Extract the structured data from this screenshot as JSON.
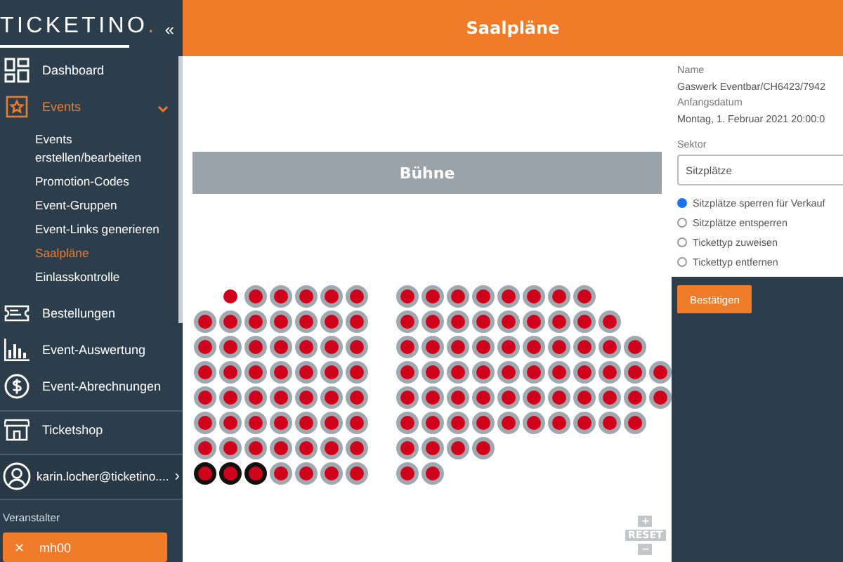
{
  "sidebar": {
    "logo": "TICKETINO",
    "logo_dot": ".",
    "collapse": "«",
    "items": [
      {
        "label": "Dashboard",
        "selected": false
      },
      {
        "label": "Events",
        "selected": true,
        "expanded": true,
        "children": [
          {
            "label": "Events erstellen/bearbeiten",
            "selected": false
          },
          {
            "label": "Promotion-Codes",
            "selected": false
          },
          {
            "label": "Event-Gruppen",
            "selected": false
          },
          {
            "label": "Event-Links generieren",
            "selected": false
          },
          {
            "label": "Saalpläne",
            "selected": true
          },
          {
            "label": "Einlasskontrolle",
            "selected": false
          }
        ]
      },
      {
        "label": "Bestellungen",
        "selected": false
      },
      {
        "label": "Event-Auswertung",
        "selected": false
      },
      {
        "label": "Event-Abrechnungen",
        "selected": false
      },
      {
        "label": "Ticketshop",
        "selected": false
      }
    ],
    "user": "karin.locher@ticketino....",
    "user_arrow": "›",
    "organizer_label": "Veranstalter",
    "organizer": {
      "remove": "✕",
      "name": "mh00"
    }
  },
  "header": {
    "title": "Saalpläne"
  },
  "seatmap": {
    "stage": "Bühne",
    "zoom": {
      "plus": "+",
      "reset": "RESET",
      "minus": "−"
    },
    "rows": [
      {
        "left": [
          {
            "kind": "dot",
            "selected": false
          },
          {
            "kind": "seat",
            "selected": false
          },
          {
            "kind": "seat",
            "selected": false
          },
          {
            "kind": "seat",
            "selected": false
          },
          {
            "kind": "seat",
            "selected": false
          },
          {
            "kind": "seat",
            "selected": false
          }
        ],
        "right": [
          {
            "kind": "seat",
            "selected": false
          },
          {
            "kind": "seat",
            "selected": false
          },
          {
            "kind": "seat",
            "selected": false
          },
          {
            "kind": "seat",
            "selected": false
          },
          {
            "kind": "seat",
            "selected": false
          },
          {
            "kind": "seat",
            "selected": false
          },
          {
            "kind": "seat",
            "selected": false
          },
          {
            "kind": "seat",
            "selected": false
          }
        ]
      },
      {
        "left": [
          {
            "kind": "seat",
            "selected": false
          },
          {
            "kind": "seat",
            "selected": false
          },
          {
            "kind": "seat",
            "selected": false
          },
          {
            "kind": "seat",
            "selected": false
          },
          {
            "kind": "seat",
            "selected": false
          },
          {
            "kind": "seat",
            "selected": false
          },
          {
            "kind": "seat",
            "selected": false
          }
        ],
        "right": [
          {
            "kind": "seat",
            "selected": false
          },
          {
            "kind": "seat",
            "selected": false
          },
          {
            "kind": "seat",
            "selected": false
          },
          {
            "kind": "seat",
            "selected": false
          },
          {
            "kind": "seat",
            "selected": false
          },
          {
            "kind": "seat",
            "selected": false
          },
          {
            "kind": "seat",
            "selected": false
          },
          {
            "kind": "seat",
            "selected": false
          },
          {
            "kind": "seat",
            "selected": false
          }
        ]
      },
      {
        "left": [
          {
            "kind": "seat",
            "selected": false
          },
          {
            "kind": "seat",
            "selected": false
          },
          {
            "kind": "seat",
            "selected": false
          },
          {
            "kind": "seat",
            "selected": false
          },
          {
            "kind": "seat",
            "selected": false
          },
          {
            "kind": "seat",
            "selected": false
          },
          {
            "kind": "seat",
            "selected": false
          }
        ],
        "right": [
          {
            "kind": "seat",
            "selected": false
          },
          {
            "kind": "seat",
            "selected": false
          },
          {
            "kind": "seat",
            "selected": false
          },
          {
            "kind": "seat",
            "selected": false
          },
          {
            "kind": "seat",
            "selected": false
          },
          {
            "kind": "seat",
            "selected": false
          },
          {
            "kind": "seat",
            "selected": false
          },
          {
            "kind": "seat",
            "selected": false
          },
          {
            "kind": "seat",
            "selected": false
          },
          {
            "kind": "seat",
            "selected": false
          }
        ]
      },
      {
        "left": [
          {
            "kind": "seat",
            "selected": false
          },
          {
            "kind": "seat",
            "selected": false
          },
          {
            "kind": "seat",
            "selected": false
          },
          {
            "kind": "seat",
            "selected": false
          },
          {
            "kind": "seat",
            "selected": false
          },
          {
            "kind": "seat",
            "selected": false
          },
          {
            "kind": "seat",
            "selected": false
          }
        ],
        "right": [
          {
            "kind": "seat",
            "selected": false
          },
          {
            "kind": "seat",
            "selected": false
          },
          {
            "kind": "seat",
            "selected": false
          },
          {
            "kind": "seat",
            "selected": false
          },
          {
            "kind": "seat",
            "selected": false
          },
          {
            "kind": "seat",
            "selected": false
          },
          {
            "kind": "seat",
            "selected": false
          },
          {
            "kind": "seat",
            "selected": false
          },
          {
            "kind": "seat",
            "selected": false
          },
          {
            "kind": "seat",
            "selected": false
          },
          {
            "kind": "seat",
            "selected": false
          }
        ]
      },
      {
        "left": [
          {
            "kind": "seat",
            "selected": false
          },
          {
            "kind": "seat",
            "selected": false
          },
          {
            "kind": "seat",
            "selected": false
          },
          {
            "kind": "seat",
            "selected": false
          },
          {
            "kind": "seat",
            "selected": false
          },
          {
            "kind": "seat",
            "selected": false
          },
          {
            "kind": "seat",
            "selected": false
          }
        ],
        "right": [
          {
            "kind": "seat",
            "selected": false
          },
          {
            "kind": "seat",
            "selected": false
          },
          {
            "kind": "seat",
            "selected": false
          },
          {
            "kind": "seat",
            "selected": false
          },
          {
            "kind": "seat",
            "selected": false
          },
          {
            "kind": "seat",
            "selected": false
          },
          {
            "kind": "seat",
            "selected": false
          },
          {
            "kind": "seat",
            "selected": false
          },
          {
            "kind": "seat",
            "selected": false
          },
          {
            "kind": "seat",
            "selected": false
          },
          {
            "kind": "seat",
            "selected": false
          }
        ]
      },
      {
        "left": [
          {
            "kind": "seat",
            "selected": false
          },
          {
            "kind": "seat",
            "selected": false
          },
          {
            "kind": "seat",
            "selected": false
          },
          {
            "kind": "seat",
            "selected": false
          },
          {
            "kind": "seat",
            "selected": false
          },
          {
            "kind": "seat",
            "selected": false
          },
          {
            "kind": "seat",
            "selected": false
          }
        ],
        "right": [
          {
            "kind": "seat",
            "selected": false
          },
          {
            "kind": "seat",
            "selected": false
          },
          {
            "kind": "seat",
            "selected": false
          },
          {
            "kind": "seat",
            "selected": false
          },
          {
            "kind": "seat",
            "selected": false
          },
          {
            "kind": "seat",
            "selected": false
          },
          {
            "kind": "seat",
            "selected": false
          },
          {
            "kind": "seat",
            "selected": false
          },
          {
            "kind": "seat",
            "selected": false
          },
          {
            "kind": "seat",
            "selected": false
          }
        ]
      },
      {
        "left": [
          {
            "kind": "seat",
            "selected": false
          },
          {
            "kind": "seat",
            "selected": false
          },
          {
            "kind": "seat",
            "selected": false
          },
          {
            "kind": "seat",
            "selected": false
          },
          {
            "kind": "seat",
            "selected": false
          },
          {
            "kind": "seat",
            "selected": false
          },
          {
            "kind": "seat",
            "selected": false
          }
        ],
        "right": [
          {
            "kind": "seat",
            "selected": false
          },
          {
            "kind": "seat",
            "selected": false
          },
          {
            "kind": "seat",
            "selected": false
          },
          {
            "kind": "seat",
            "selected": false
          }
        ]
      },
      {
        "left": [
          {
            "kind": "seat",
            "selected": true
          },
          {
            "kind": "seat",
            "selected": true
          },
          {
            "kind": "seat",
            "selected": true
          },
          {
            "kind": "seat",
            "selected": false
          },
          {
            "kind": "seat",
            "selected": false
          },
          {
            "kind": "seat",
            "selected": false
          },
          {
            "kind": "seat",
            "selected": false
          }
        ],
        "right": [
          {
            "kind": "seat",
            "selected": false
          },
          {
            "kind": "seat",
            "selected": false
          }
        ]
      }
    ]
  },
  "panel": {
    "name_label": "Name",
    "name": "Gaswerk Eventbar/CH6423/7942",
    "date_label": "Anfangsdatum",
    "date": "Montag, 1. Februar 2021 20:00:0",
    "sector_label": "Sektor",
    "sector": "Sitzplätze",
    "options": [
      {
        "label": "Sitzplätze sperren für Verkauf",
        "selected": true
      },
      {
        "label": "Sitzplätze entsperren",
        "selected": false
      },
      {
        "label": "Tickettyp zuweisen",
        "selected": false
      },
      {
        "label": "Tickettyp entfernen",
        "selected": false
      }
    ],
    "confirm": "Bestätigen"
  }
}
